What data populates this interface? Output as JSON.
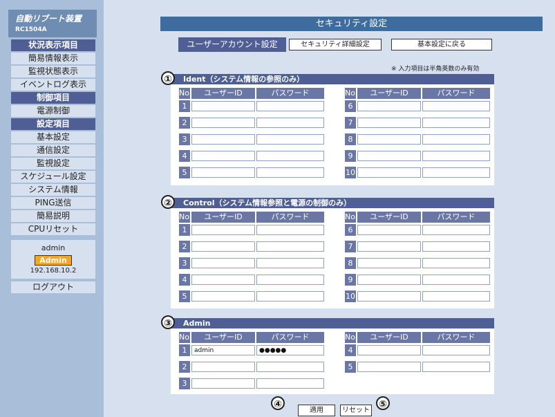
{
  "sidebar": {
    "logo_title": "自動リブート装置",
    "logo_model": "RC1504A",
    "items": [
      {
        "label": "状況表示項目",
        "head": true
      },
      {
        "label": "簡易情報表示",
        "head": false
      },
      {
        "label": "監視状態表示",
        "head": false
      },
      {
        "label": "イベントログ表示",
        "head": false
      },
      {
        "label": "制御項目",
        "head": true
      },
      {
        "label": "電源制御",
        "head": false
      },
      {
        "label": "設定項目",
        "head": true
      },
      {
        "label": "基本設定",
        "head": false
      },
      {
        "label": "通信設定",
        "head": false
      },
      {
        "label": "監視設定",
        "head": false
      },
      {
        "label": "スケジュール設定",
        "head": false
      },
      {
        "label": "システム情報",
        "head": false
      },
      {
        "label": "PING送信",
        "head": false
      },
      {
        "label": "簡易説明",
        "head": false
      },
      {
        "label": "CPUリセット",
        "head": false
      }
    ],
    "user": {
      "name": "admin",
      "badge": "Admin",
      "ip": "192.168.10.2"
    },
    "logout": "ログアウト"
  },
  "main": {
    "title": "セキュリティ設定",
    "tab_active": "ユーザーアカウント設定",
    "btn_security_detail": "セキュリティ詳細設定",
    "btn_back": "基本設定に戻る",
    "note": "※ 入力項目は半角英数のみ有効",
    "col_no": "No.",
    "col_user": "ユーザーID",
    "col_pass": "パスワード",
    "sections": [
      {
        "marker": "①",
        "title": "Ident（システム情報の参照のみ）",
        "left": [
          "1",
          "2",
          "3",
          "4",
          "5"
        ],
        "right": [
          "6",
          "7",
          "8",
          "9",
          "10"
        ],
        "left_values": [
          [
            "",
            ""
          ],
          [
            "",
            ""
          ],
          [
            "",
            ""
          ],
          [
            "",
            ""
          ],
          [
            "",
            ""
          ]
        ]
      },
      {
        "marker": "②",
        "title": "Control（システム情報参照と電源の制御のみ）",
        "left": [
          "1",
          "2",
          "3",
          "4",
          "5"
        ],
        "right": [
          "6",
          "7",
          "8",
          "9",
          "10"
        ],
        "left_values": [
          [
            "",
            ""
          ],
          [
            "",
            ""
          ],
          [
            "",
            ""
          ],
          [
            "",
            ""
          ],
          [
            "",
            ""
          ]
        ]
      },
      {
        "marker": "③",
        "title": "Admin",
        "left": [
          "1",
          "2",
          "3"
        ],
        "right": [
          "4",
          "5"
        ],
        "left_values": [
          [
            "admin",
            "●●●●●"
          ],
          [
            "",
            ""
          ],
          [
            "",
            ""
          ]
        ]
      }
    ],
    "marker4": "④",
    "marker5": "⑤",
    "btn_apply": "適用",
    "btn_reset": "リセット"
  }
}
